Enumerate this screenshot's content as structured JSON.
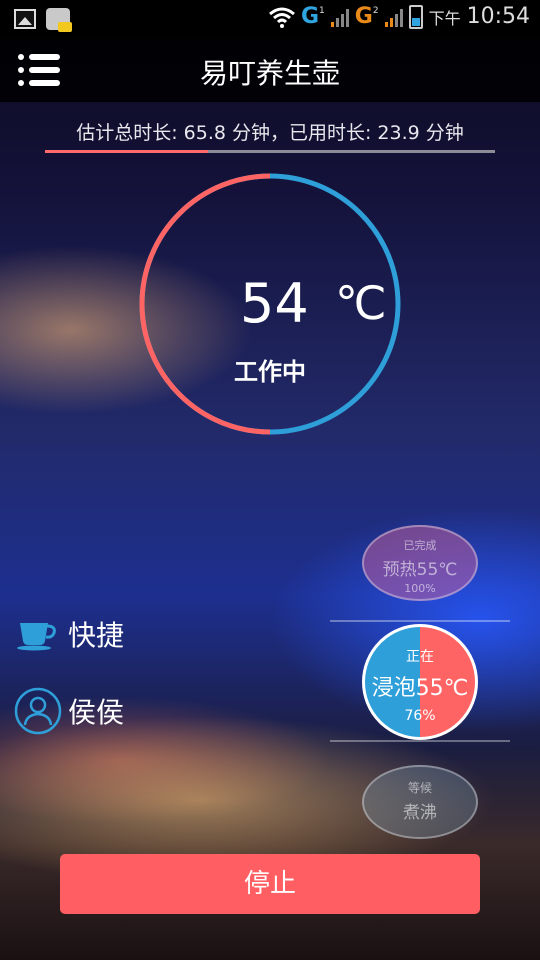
{
  "status_bar": {
    "network_1": "G",
    "sim_1": "1",
    "network_2": "G",
    "sim_2": "2",
    "ampm": "下午",
    "time": "10:54"
  },
  "app_bar": {
    "title": "易叮养生壶",
    "menu_icon": "menu-icon"
  },
  "duration": {
    "text": "估计总时长: 65.8 分钟，已用时长: 23.9 分钟",
    "total_minutes": 65.8,
    "used_minutes": 23.9
  },
  "gauge": {
    "temperature": "54",
    "unit": "℃",
    "state": "工作中",
    "progress_fraction": 0.5
  },
  "side_menu": {
    "quick_label": "快捷",
    "quick_icon": "cup-icon",
    "user_label": "侯侯",
    "user_icon": "user-icon"
  },
  "steps": [
    {
      "status": "已完成",
      "name": "预热55℃",
      "percent": "100%"
    },
    {
      "status": "正在",
      "name": "浸泡55℃",
      "percent": "76%"
    },
    {
      "status": "等候",
      "name": "煮沸"
    }
  ],
  "stop_button": "停止",
  "colors": {
    "accent_red": "#ff6464",
    "accent_blue": "#2e9fd8",
    "stop_button": "#ff5f62"
  }
}
